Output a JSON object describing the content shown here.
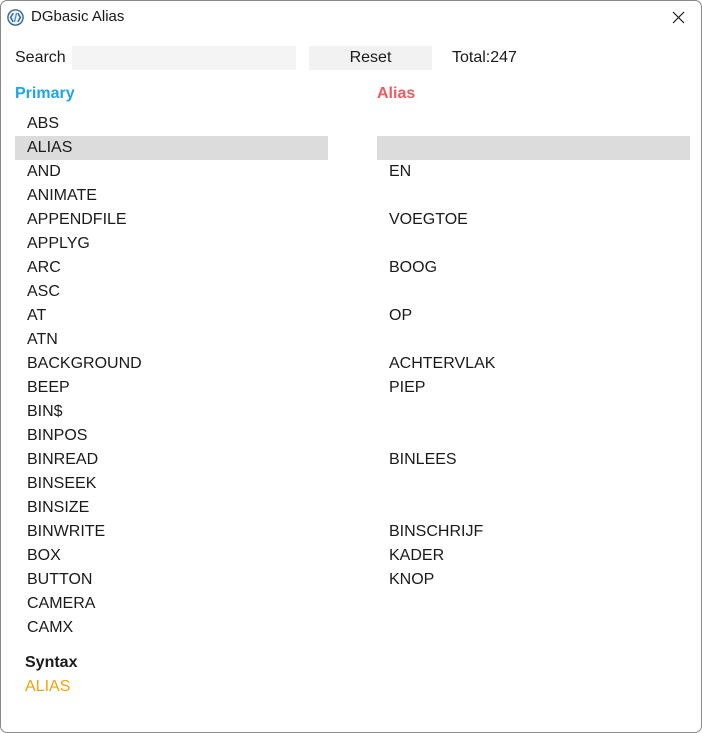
{
  "window": {
    "title": "DGbasic Alias"
  },
  "search": {
    "label": "Search",
    "value": "",
    "placeholder": ""
  },
  "reset_label": "Reset",
  "total": {
    "label": "Total:",
    "count": "247"
  },
  "columns": {
    "primary_header": "Primary",
    "alias_header": "Alias"
  },
  "rows": [
    {
      "primary": "ABS",
      "alias": ""
    },
    {
      "primary": "ALIAS",
      "alias": ""
    },
    {
      "primary": "AND",
      "alias": "EN"
    },
    {
      "primary": "ANIMATE",
      "alias": ""
    },
    {
      "primary": "APPENDFILE",
      "alias": "VOEGTOE"
    },
    {
      "primary": "APPLYG",
      "alias": ""
    },
    {
      "primary": "ARC",
      "alias": "BOOG"
    },
    {
      "primary": "ASC",
      "alias": ""
    },
    {
      "primary": "AT",
      "alias": "OP"
    },
    {
      "primary": "ATN",
      "alias": ""
    },
    {
      "primary": "BACKGROUND",
      "alias": "ACHTERVLAK"
    },
    {
      "primary": "BEEP",
      "alias": "PIEP"
    },
    {
      "primary": "BIN$",
      "alias": ""
    },
    {
      "primary": "BINPOS",
      "alias": ""
    },
    {
      "primary": "BINREAD",
      "alias": "BINLEES"
    },
    {
      "primary": "BINSEEK",
      "alias": ""
    },
    {
      "primary": "BINSIZE",
      "alias": ""
    },
    {
      "primary": "BINWRITE",
      "alias": "BINSCHRIJF"
    },
    {
      "primary": "BOX",
      "alias": "KADER"
    },
    {
      "primary": "BUTTON",
      "alias": "KNOP"
    },
    {
      "primary": "CAMERA",
      "alias": ""
    },
    {
      "primary": "CAMX",
      "alias": ""
    }
  ],
  "selected_index": 1,
  "syntax": {
    "label": "Syntax",
    "value": "ALIAS"
  },
  "colors": {
    "primary_header": "#1ea5e8",
    "alias_header": "#ef5a5f",
    "syntax_value": "#f0a30a",
    "selection": "#dcdcdc"
  }
}
